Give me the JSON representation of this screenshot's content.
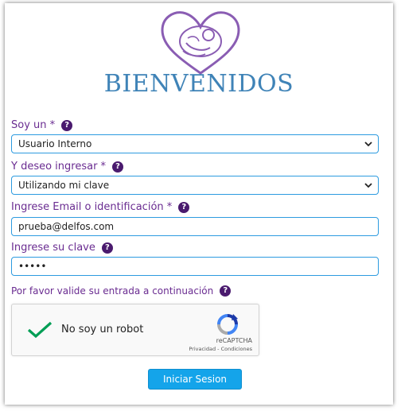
{
  "logo": {
    "icon": "baby-heart-logo",
    "color": "#8a5db3"
  },
  "title": "BIENVENIDOS",
  "user_type": {
    "label": "Soy un *",
    "value": "Usuario Interno"
  },
  "access_mode": {
    "label": "Y deseo ingresar *",
    "value": "Utilizando mi clave"
  },
  "email": {
    "label": "Ingrese Email o identificación *",
    "value": "prueba@delfos.com"
  },
  "password": {
    "label": "Ingrese su clave",
    "value": "•••••"
  },
  "captcha_prompt": "Por favor valide su entrada a continuación",
  "recaptcha": {
    "label": "No soy un robot",
    "brand": "reCAPTCHA",
    "privacy": "Privacidad",
    "separator": " - ",
    "terms": "Condiciones",
    "checked": true
  },
  "submit_label": "Iniciar Sesion",
  "colors": {
    "accent": "#14a4ea",
    "label_purple": "#6a2c91",
    "title_blue": "#3f83b7",
    "field_border": "#2d9be0"
  }
}
